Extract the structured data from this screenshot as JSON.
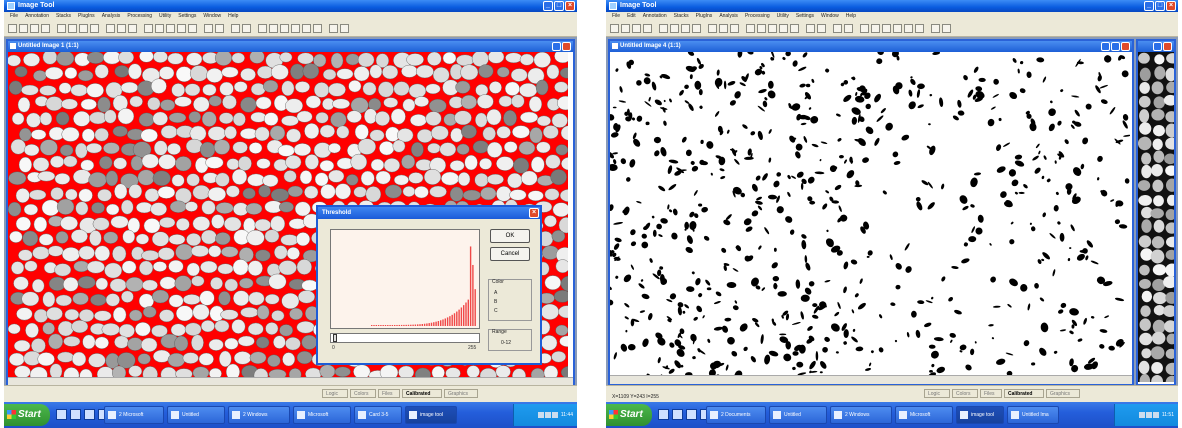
{
  "left": {
    "app_title": "Image Tool",
    "menu": [
      "File",
      "Annotation",
      "Stacks",
      "PlugIns",
      "Analysis",
      "Processing",
      "Utility",
      "Settings",
      "Window",
      "Help"
    ],
    "child_title": "Untitled Image 1 (1:1)",
    "dialog": {
      "title": "Threshold",
      "ok_label": "OK",
      "cancel_label": "Cancel",
      "color_label": "Color",
      "color_values": [
        "A",
        "B",
        "C"
      ],
      "range_label": "Range",
      "range_value": "0-12",
      "scale_min": "0",
      "scale_max": "255"
    },
    "status_cells": [
      "Logic",
      "Colors",
      "Files",
      "Calibrated",
      "Graphics"
    ],
    "status_active": "Calibrated",
    "taskbar": {
      "start_label": "Start",
      "tasks": [
        "2 Microsoft",
        "Untitled",
        "2 Windows",
        "Microsoft",
        "Card 3-5",
        "image tool"
      ],
      "active_task": "image tool",
      "clock": "11:44"
    }
  },
  "right": {
    "app_title": "Image Tool",
    "menu": [
      "File",
      "Edit",
      "Annotation",
      "Stacks",
      "PlugIns",
      "Analysis",
      "Processing",
      "Utility",
      "Settings",
      "Window",
      "Help"
    ],
    "child_title": "Untitled Image 4 (1:1)",
    "coords_text": "X=1109 Y=243 I=255",
    "status_cells": [
      "Logic",
      "Colors",
      "Files",
      "Calibrated",
      "Graphics"
    ],
    "status_active": "Calibrated",
    "taskbar": {
      "start_label": "Start",
      "tasks": [
        "2 Documents",
        "Untitled",
        "2 Windows",
        "Microsoft",
        "image tool",
        "Untitled Ima"
      ],
      "active_task": "image tool",
      "clock": "11:51"
    }
  },
  "colors": {
    "xp_blue": "#245edb",
    "threshold_red": "#ff0000",
    "start_green": "#3c9c3c"
  }
}
